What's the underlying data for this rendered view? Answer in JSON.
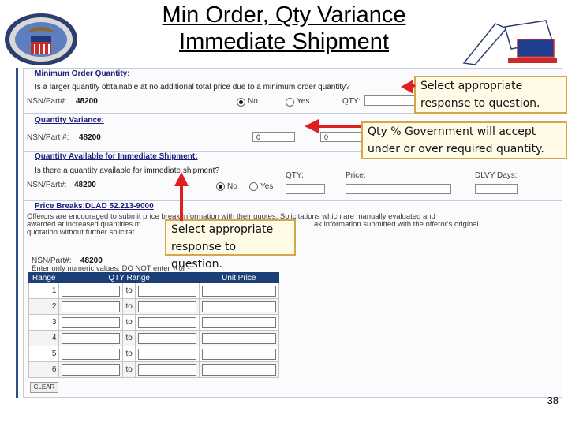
{
  "slide": {
    "title_line1": "Min Order, Qty Variance",
    "title_line2": "Immediate Shipment",
    "page_number": "38"
  },
  "min_order": {
    "heading": "Minimum Order Quantity:",
    "question": "Is a larger quantity obtainable at no additional total price due to a minimum order quantity?",
    "nsn_label": "NSN/Part#:",
    "nsn_value": "48200",
    "no_label": "No",
    "yes_label": "Yes",
    "qty_label": "QTY:"
  },
  "qty_variance": {
    "heading": "Quantity Variance:",
    "nsn_label": "NSN/Part #:",
    "nsn_value": "48200",
    "field1_value": "0",
    "field2_value": "0"
  },
  "immediate": {
    "heading": "Quantity Available for Immediate Shipment:",
    "question": "Is there a quantity available for immediate shipment?",
    "nsn_label": "NSN/Part#:",
    "nsn_value": "48200",
    "no_label": "No",
    "yes_label": "Yes",
    "qty_label": "QTY:",
    "price_label": "Price:",
    "delv_label": "DLVY Days:"
  },
  "price_breaks": {
    "heading": "Price Breaks:DLAD 52.213-9000",
    "text_line1": "Offerors are encouraged to submit price break information with their quotes. Solicitations which are manually evaluated and",
    "text_line2": "awarded at increased quantities m",
    "text_line2b": "ak information submitted with the offeror's original",
    "text_line3": "quotation without further solicitat",
    "nsn_label": "NSN/Part#:",
    "nsn_value": "48200",
    "note": "Enter only numeric values. DO NOT enter + or -",
    "col_range": "Range",
    "col_qty": "QTY Range",
    "col_price": "Unit Price",
    "to_label": "to",
    "rows": [
      "1",
      "2",
      "3",
      "4",
      "5",
      "6"
    ],
    "clear_label": "CLEAR"
  },
  "callouts": {
    "c1_line1": "Select appropriate",
    "c1_line2": "response to question.",
    "c2_line1": "Qty % Government will accept",
    "c2_line2": "under or over required quantity.",
    "c3_line1": "Select appropriate",
    "c3_line2": "response to question."
  },
  "colors": {
    "arrow": "#e02020",
    "header_bar": "#1c3f77",
    "callout_border": "#d4a84a"
  }
}
